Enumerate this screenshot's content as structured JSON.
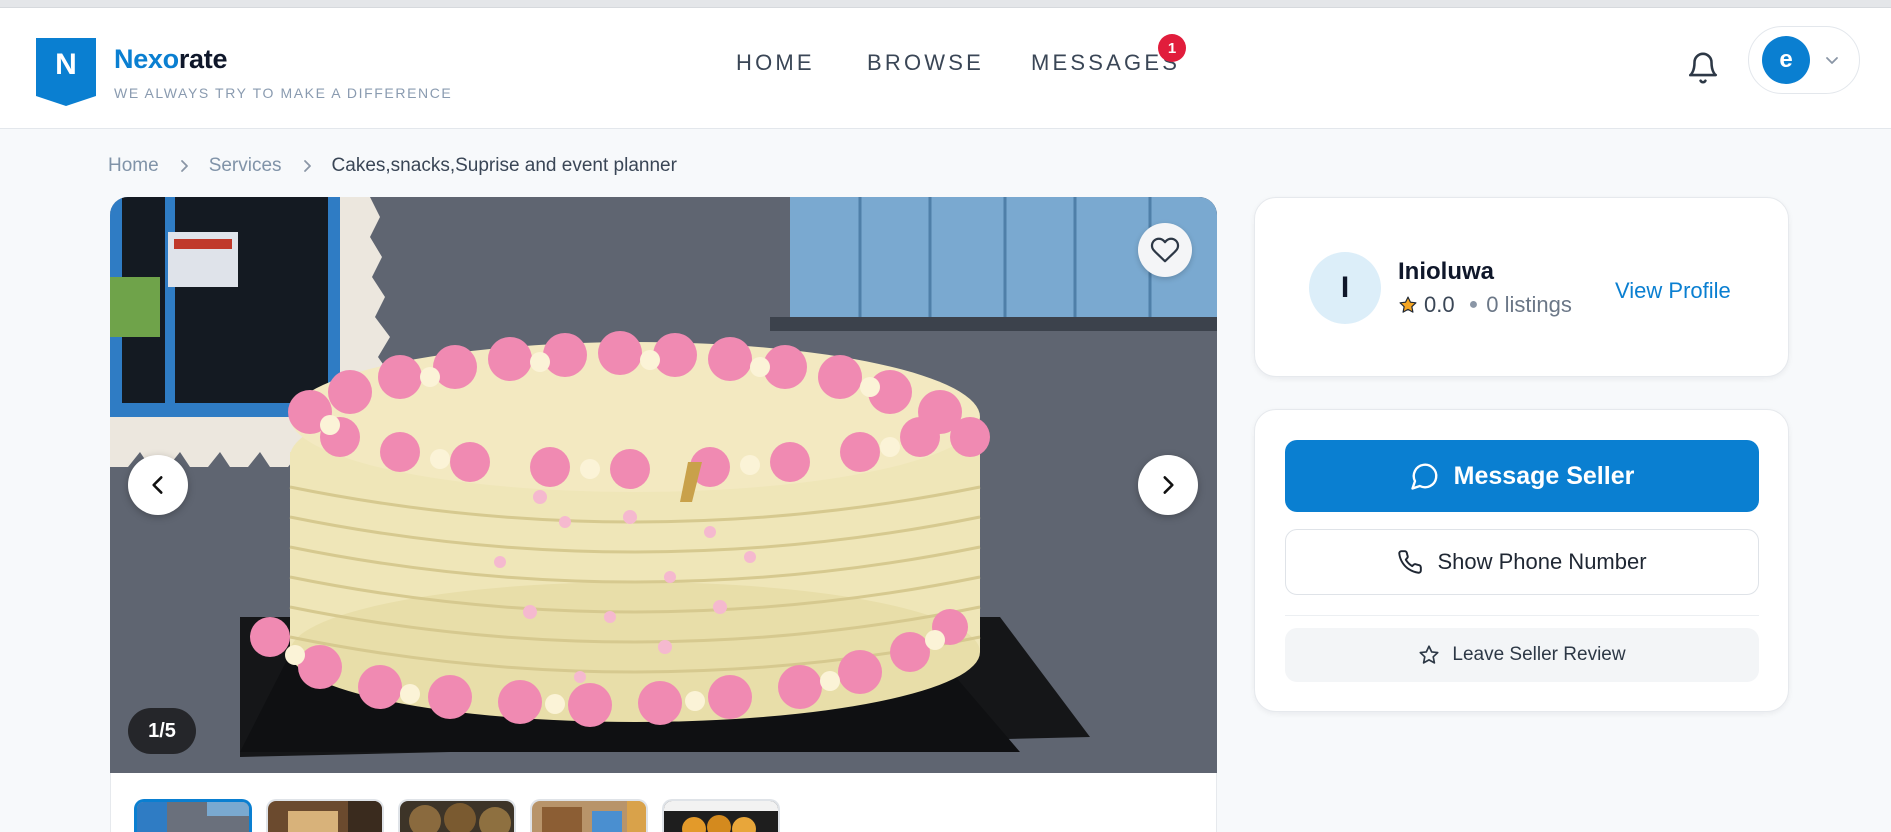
{
  "brand": {
    "logo_letter": "N",
    "name_part1": "Nexo",
    "name_part2": "rate",
    "tagline": "WE ALWAYS TRY TO MAKE A DIFFERENCE"
  },
  "nav": {
    "home": "HOME",
    "browse": "BROWSE",
    "messages": "MESSAGES",
    "messages_badge": "1"
  },
  "user": {
    "avatar_letter": "e"
  },
  "breadcrumb": {
    "home": "Home",
    "services": "Services",
    "current": "Cakes,snacks,Suprise and event planner"
  },
  "gallery": {
    "counter": "1/5",
    "current_index": 1,
    "total": 5
  },
  "seller": {
    "avatar_letter": "I",
    "name": "Inioluwa",
    "rating": "0.0",
    "listings": "0 listings",
    "view_profile": "View Profile"
  },
  "actions": {
    "message_seller": "Message Seller",
    "show_phone": "Show Phone Number",
    "leave_review": "Leave Seller Review"
  },
  "colors": {
    "primary": "#0a7fd1",
    "badge": "#e11d3c",
    "rating_star": "#f5a623"
  },
  "icons": [
    "bell-icon",
    "chevron-down-icon",
    "chevron-right-icon",
    "heart-icon",
    "chevron-left-icon",
    "chat-bubble-icon",
    "phone-icon",
    "star-outline-icon",
    "star-filled-icon"
  ]
}
